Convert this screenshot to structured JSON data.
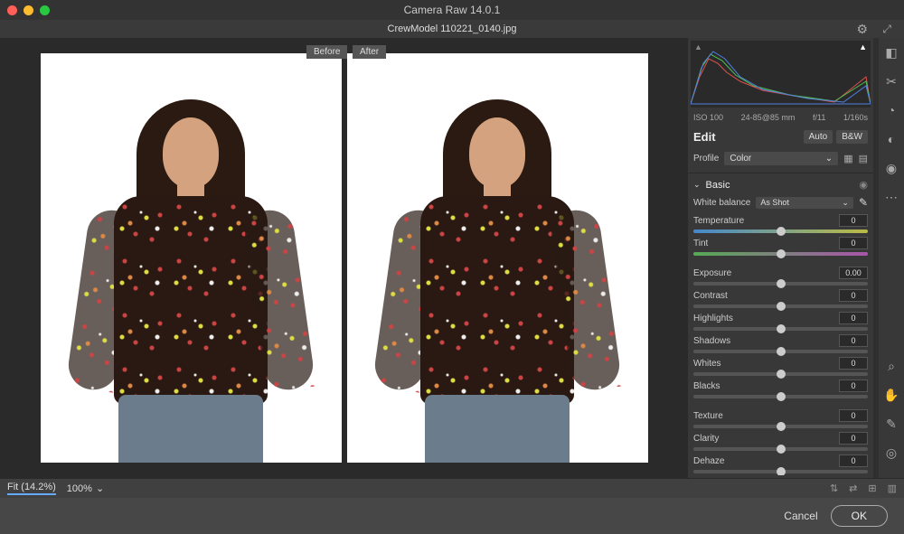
{
  "app": {
    "title": "Camera Raw 14.0.1",
    "filename": "CrewModel 110221_0140.jpg"
  },
  "topbar": {
    "gear_icon": "⚙",
    "expand_icon": "⤢"
  },
  "tabs": {
    "before": "Before",
    "after": "After"
  },
  "meta": {
    "iso": "ISO 100",
    "lens": "24-85@85 mm",
    "aperture": "f/11",
    "shutter": "1/160s"
  },
  "edit": {
    "header": "Edit",
    "auto": "Auto",
    "bw": "B&W"
  },
  "profile": {
    "label": "Profile",
    "value": "Color",
    "chev": "⌄",
    "grid_icon": "▦",
    "browse_icon": "▤"
  },
  "basic": {
    "header": "Basic",
    "chev": "⌄",
    "eye": "◉",
    "wb_label": "White balance",
    "wb_value": "As Shot",
    "wb_chev": "⌄",
    "picker_icon": "✎"
  },
  "sliders": [
    {
      "label": "Temperature",
      "value": "0",
      "track": "temp"
    },
    {
      "label": "Tint",
      "value": "0",
      "track": "tint"
    },
    {
      "label": "Exposure",
      "value": "0.00",
      "track": ""
    },
    {
      "label": "Contrast",
      "value": "0",
      "track": ""
    },
    {
      "label": "Highlights",
      "value": "0",
      "track": ""
    },
    {
      "label": "Shadows",
      "value": "0",
      "track": ""
    },
    {
      "label": "Whites",
      "value": "0",
      "track": ""
    },
    {
      "label": "Blacks",
      "value": "0",
      "track": ""
    },
    {
      "label": "Texture",
      "value": "0",
      "track": ""
    },
    {
      "label": "Clarity",
      "value": "0",
      "track": ""
    },
    {
      "label": "Dehaze",
      "value": "0",
      "track": ""
    }
  ],
  "tools": {
    "edit": "◧",
    "crop": "✂",
    "heal": "◔",
    "mask": "◐",
    "redeye": "◉",
    "more": "⋯",
    "zoom": "⌕",
    "hand": "✋",
    "wb": "✎",
    "targ": "◎"
  },
  "bottom": {
    "fit": "Fit (14.2%)",
    "zoom": "100%",
    "chev": "⌄",
    "i1": "⇅",
    "i2": "⇄",
    "i3": "⊞",
    "i4": "▥"
  },
  "footer": {
    "cancel": "Cancel",
    "ok": "OK"
  }
}
